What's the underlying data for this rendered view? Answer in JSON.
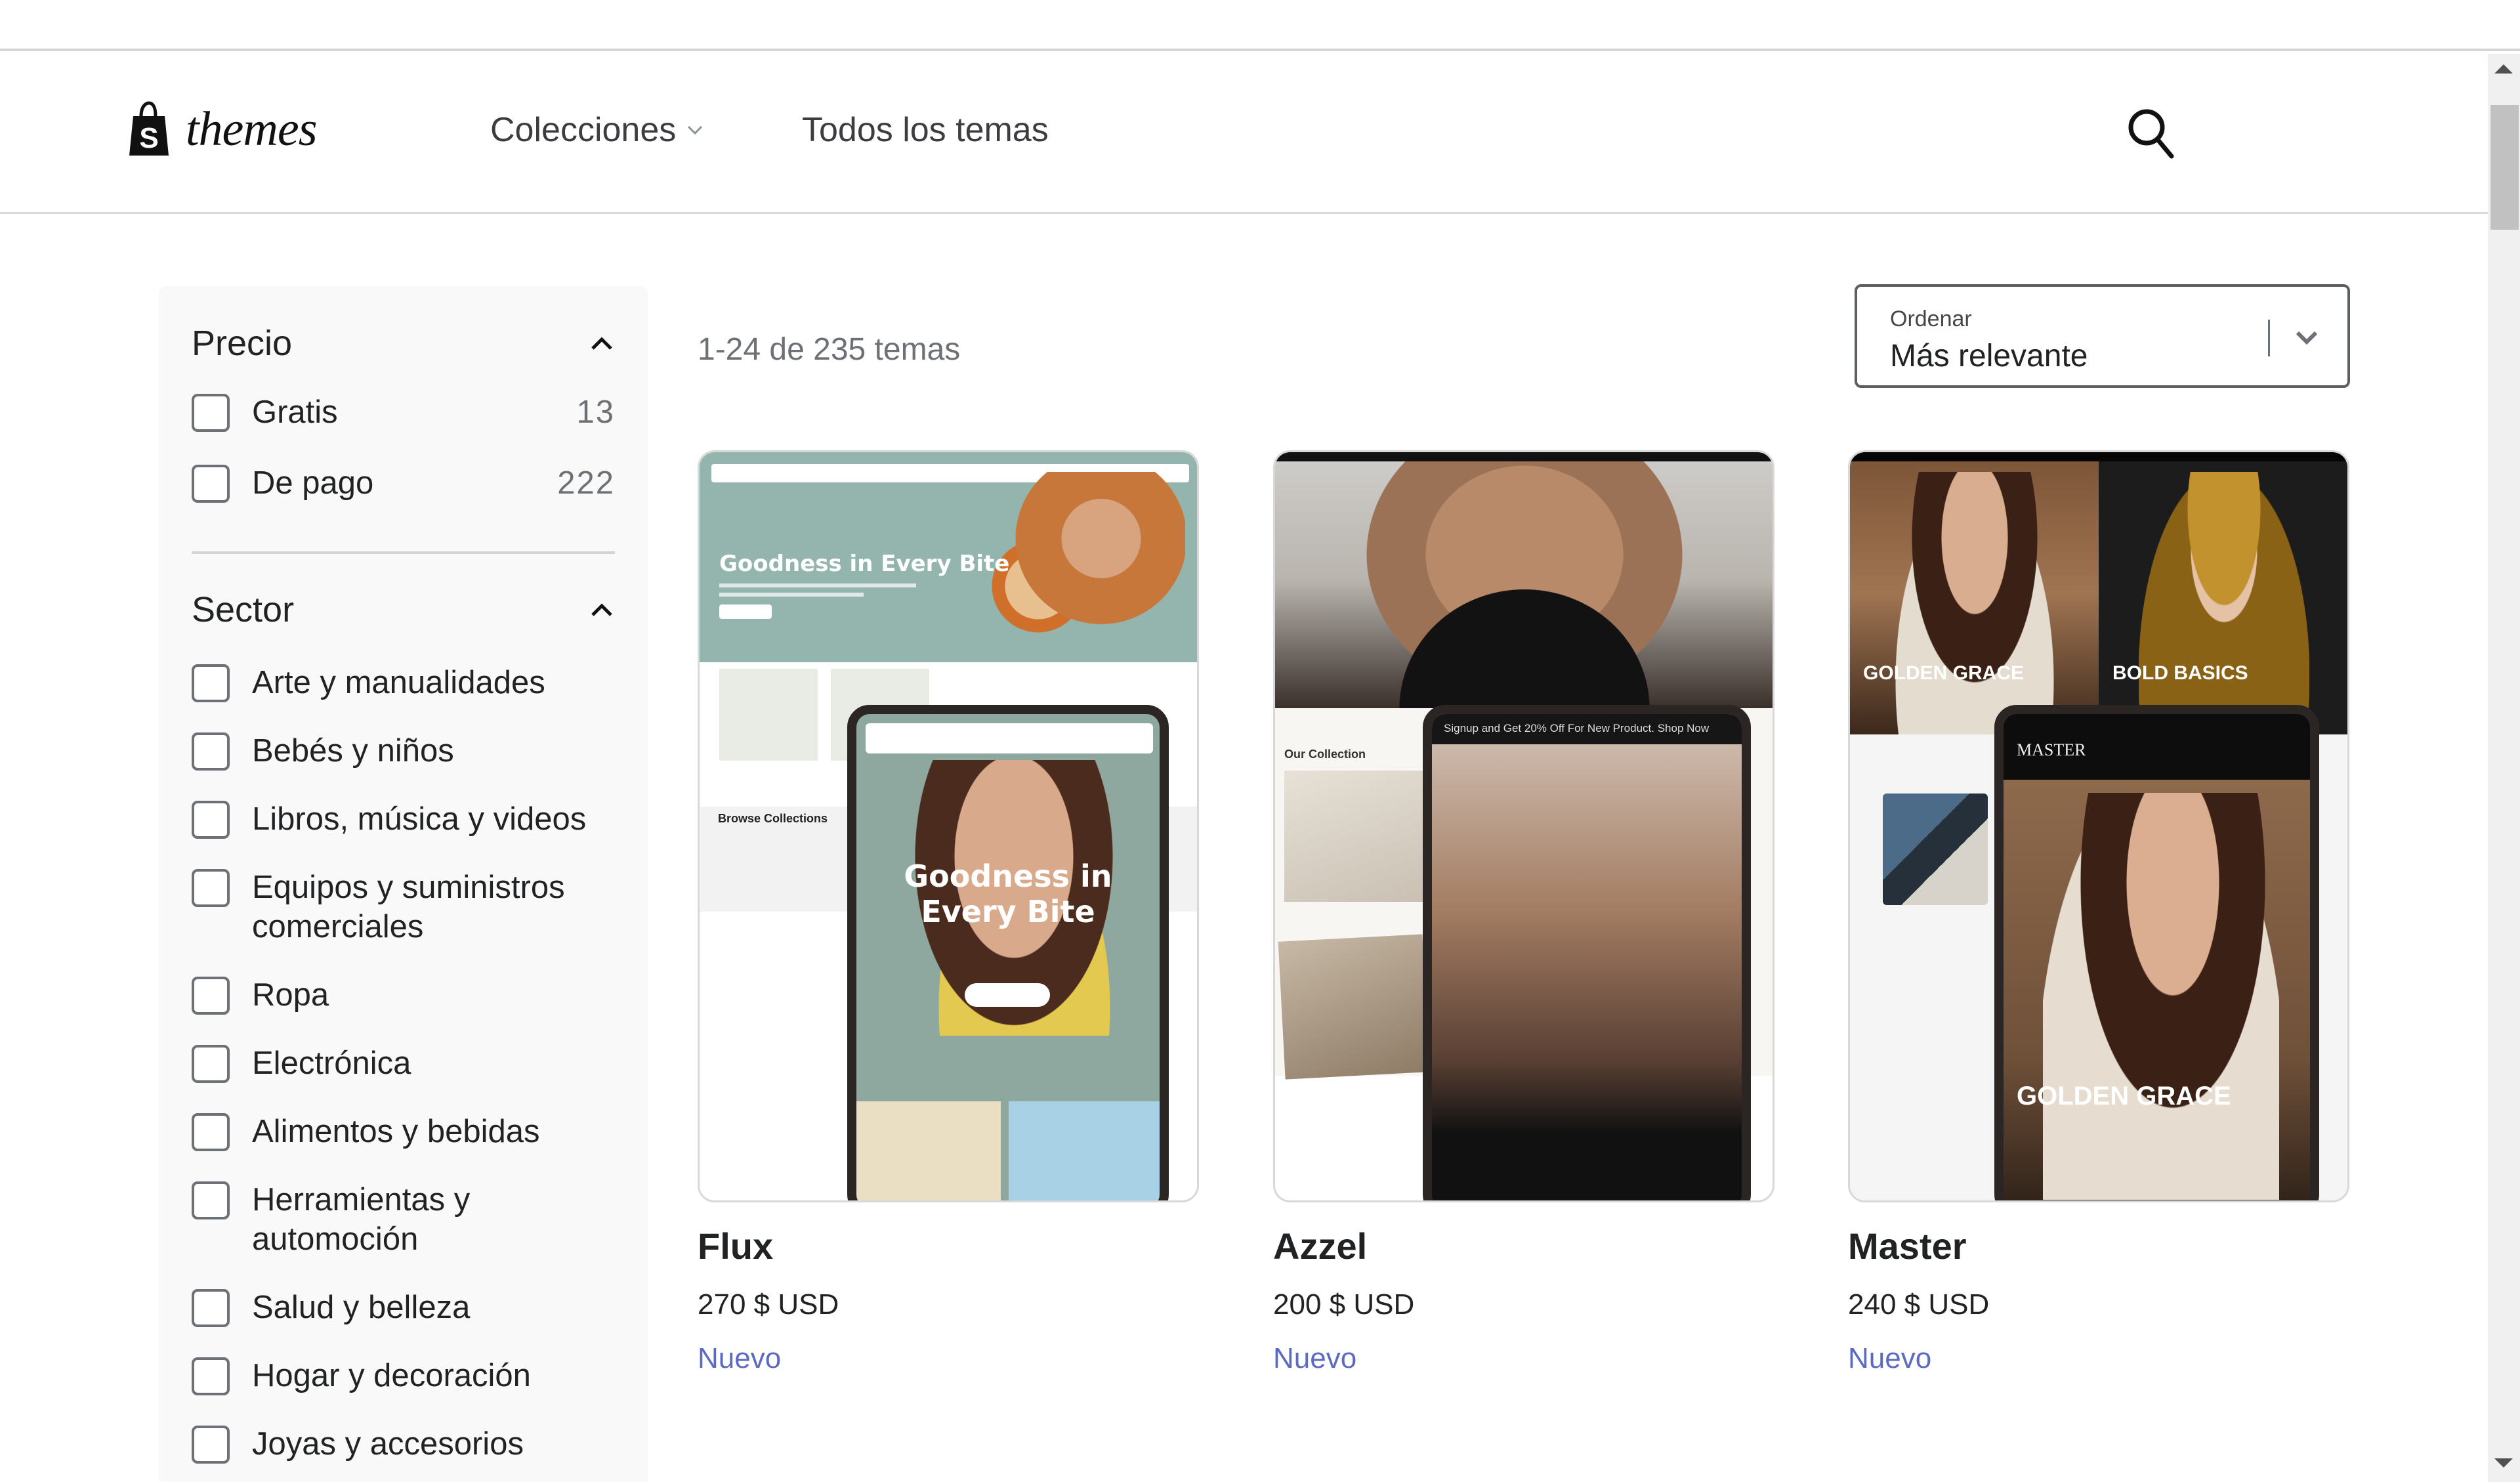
{
  "header": {
    "logo_text": "themes",
    "nav": [
      {
        "label": "Colecciones",
        "has_dropdown": true
      },
      {
        "label": "Todos los temas",
        "has_dropdown": false
      }
    ],
    "search_icon": "search-icon"
  },
  "sidebar": {
    "price": {
      "title": "Precio",
      "expanded": true,
      "options": [
        {
          "label": "Gratis",
          "count": "13",
          "checked": false
        },
        {
          "label": "De pago",
          "count": "222",
          "checked": false
        }
      ]
    },
    "sector": {
      "title": "Sector",
      "expanded": true,
      "options": [
        {
          "label": "Arte y manualidades",
          "checked": false
        },
        {
          "label": "Bebés y niños",
          "checked": false
        },
        {
          "label": "Libros, música y videos",
          "checked": false
        },
        {
          "label": "Equipos y suministros comerciales",
          "checked": false
        },
        {
          "label": "Ropa",
          "checked": false
        },
        {
          "label": "Electrónica",
          "checked": false
        },
        {
          "label": "Alimentos y bebidas",
          "checked": false
        },
        {
          "label": "Herramientas y automoción",
          "checked": false
        },
        {
          "label": "Salud y belleza",
          "checked": false
        },
        {
          "label": "Hogar y decoración",
          "checked": false
        },
        {
          "label": "Joyas y accesorios",
          "checked": false
        }
      ]
    }
  },
  "results": {
    "count_text": "1-24 de 235 temas",
    "sort": {
      "label": "Ordenar",
      "value": "Más relevante"
    }
  },
  "themes": [
    {
      "name": "Flux",
      "price": "270 $ USD",
      "badge": "Nuevo",
      "preview": {
        "headline": "Goodness in Every Bite",
        "section": "Browse Collections"
      }
    },
    {
      "name": "Azzel",
      "price": "200 $ USD",
      "badge": "Nuevo",
      "preview": {
        "banner": "Signup and Get 20% Off For New Product. Shop Now",
        "section": "Our Collection"
      }
    },
    {
      "name": "Master",
      "price": "240 $ USD",
      "badge": "Nuevo",
      "preview": {
        "logo": "MASTER",
        "headline_left": "GOLDEN GRACE",
        "headline_right": "BOLD BASICS"
      }
    }
  ],
  "colors": {
    "badge": "#5c6ac4",
    "muted_text": "#6d7175",
    "sidebar_bg": "#f9f9f9"
  }
}
